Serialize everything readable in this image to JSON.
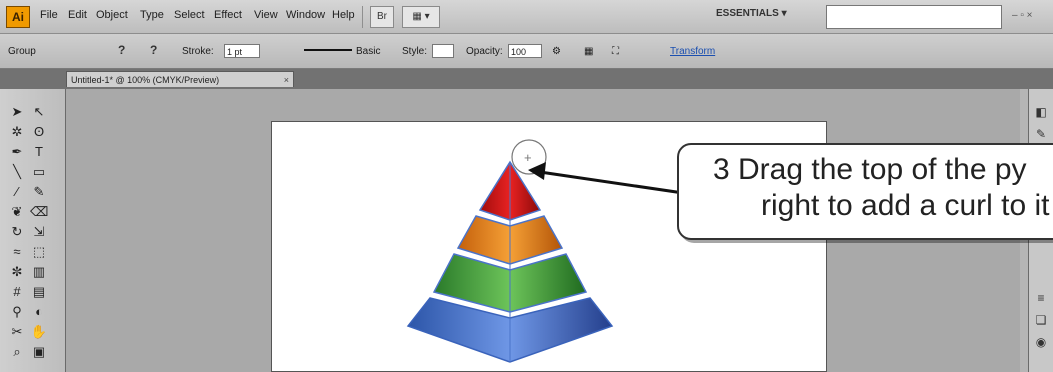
{
  "app": {
    "logo": "Ai"
  },
  "menu": {
    "items": [
      "File",
      "Edit",
      "Object",
      "Type",
      "Select",
      "Effect",
      "View",
      "Window",
      "Help"
    ]
  },
  "menubar": {
    "bridge_label": "Br",
    "arrange_label": "▦ ▾",
    "workspace": "ESSENTIALS ▾",
    "search_placeholder": "",
    "window_controls": "– ▫ ×"
  },
  "control": {
    "selection_label": "Group",
    "stroke_label": "Stroke:",
    "stroke_value": "1 pt",
    "profile_label": "Basic",
    "style_label": "Style:",
    "opacity_label": "Opacity:",
    "opacity_value": "100",
    "transform_link": "Transform"
  },
  "document": {
    "tab_title": "Untitled-1* @ 100% (CMYK/Preview)",
    "close": "×"
  },
  "tools": {
    "icons": [
      "selection-tool-icon",
      "direct-selection-tool-icon",
      "magic-wand-icon",
      "lasso-icon",
      "pen-tool-icon",
      "type-tool-icon",
      "line-tool-icon",
      "rectangle-tool-icon",
      "paintbrush-icon",
      "pencil-icon",
      "blob-brush-icon",
      "eraser-icon",
      "rotate-tool-icon",
      "scale-tool-icon",
      "warp-tool-icon",
      "free-transform-icon",
      "symbol-sprayer-icon",
      "graph-tool-icon",
      "mesh-tool-icon",
      "gradient-tool-icon",
      "eyedropper-icon",
      "blend-tool-icon",
      "slice-tool-icon",
      "hand-tool-icon",
      "zoom-tool-icon",
      "artboard-tool-icon"
    ]
  },
  "pyramid_colors": {
    "top": "#e01818",
    "second": "#f08a1a",
    "third": "#3ca23c",
    "bottom": "#3f6fd0"
  },
  "callout": {
    "line1": "3 Drag the top of the py",
    "line2": "right to add a curl to it"
  }
}
